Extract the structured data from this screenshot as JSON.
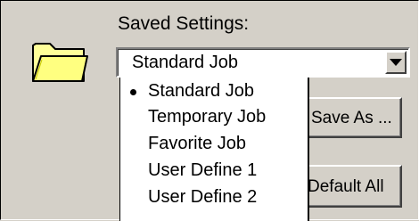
{
  "saved_settings": {
    "label": "Saved Settings:",
    "selected_value": "Standard Job",
    "options": [
      {
        "label": "Standard Job",
        "selected": true
      },
      {
        "label": "Temporary Job",
        "selected": false
      },
      {
        "label": "Favorite Job",
        "selected": false
      },
      {
        "label": "User Define 1",
        "selected": false
      },
      {
        "label": "User Define 2",
        "selected": false
      }
    ]
  },
  "buttons": {
    "save_as": "Save As ...",
    "default_all": "Default All"
  },
  "icons": {
    "folder": "folder-icon",
    "dropdown_arrow": "chevron-down-icon",
    "selected_marker": "bullet-icon"
  },
  "colors": {
    "dialog_background": "#d4d0c8",
    "folder_fill": "#ffff99",
    "folder_outline": "#000000"
  }
}
